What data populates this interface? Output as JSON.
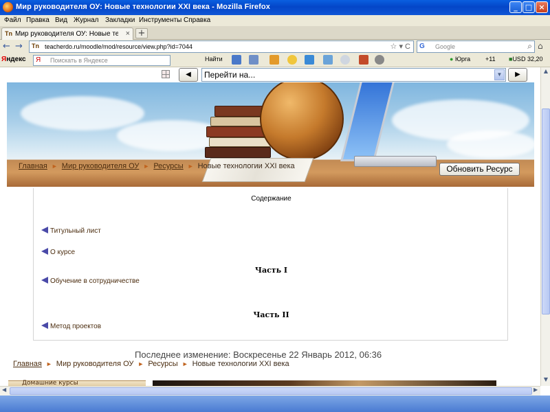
{
  "window": {
    "title": "Мир руководителя ОУ: Новые технологии XXI века - Mozilla Firefox",
    "minimize_label": "_",
    "maximize_label": "□",
    "close_label": "×"
  },
  "menu": [
    "Файл",
    "Правка",
    "Вид",
    "Журнал",
    "Закладки",
    "Инструменты",
    "Справка"
  ],
  "tab": {
    "favicon": "Tn",
    "label": "Мир руководителя ОУ: Новые технологи...",
    "close": "×",
    "new_tab": "+"
  },
  "nav": {
    "back": "←",
    "forward": "→",
    "url": "teacherdo.ru/moodle/mod/resource/view.php?id=7044",
    "url_icons": "☆ ▾ C",
    "search_engine": "G",
    "search_placeholder": "Google",
    "search_icon": "magnifier-icon",
    "home": "⌂"
  },
  "yandex": {
    "logo_prefix": "Я",
    "logo_rest": "ндекс",
    "search_placeholder": "Поискать в Яндексе",
    "find_label": "Найти",
    "weather": "Юрга",
    "temperature": "+11",
    "currency": "USD 32,20"
  },
  "page": {
    "jump_label": "Перейти на...",
    "prev": "◀",
    "next": "▶",
    "breadcrumb": [
      {
        "label": "Главная"
      },
      {
        "label": "Мир руководителя ОУ"
      },
      {
        "label": "Ресурсы"
      }
    ],
    "breadcrumb_current": "Новые технологии XXI века",
    "breadcrumb_sep": "►",
    "update_button": "Обновить Ресурс",
    "toc_title": "Содержание",
    "toc": {
      "item1": "Титульный лист",
      "item2": "О курсе",
      "part1": "Часть I",
      "item3": "Обучение в сотрудничестве",
      "part2": "Часть II",
      "item4": "Метод проектов"
    },
    "last_modified": "Последнее изменение: Воскресенье 22 Январь 2012, 06:36",
    "sidebar_label": "Домашние курсы"
  },
  "colors": {
    "titlebar": "#0446c8",
    "link": "#4b2c0e",
    "breadcrumb_sep": "#c0631e",
    "toc_arrow": "#4a4aa8"
  }
}
